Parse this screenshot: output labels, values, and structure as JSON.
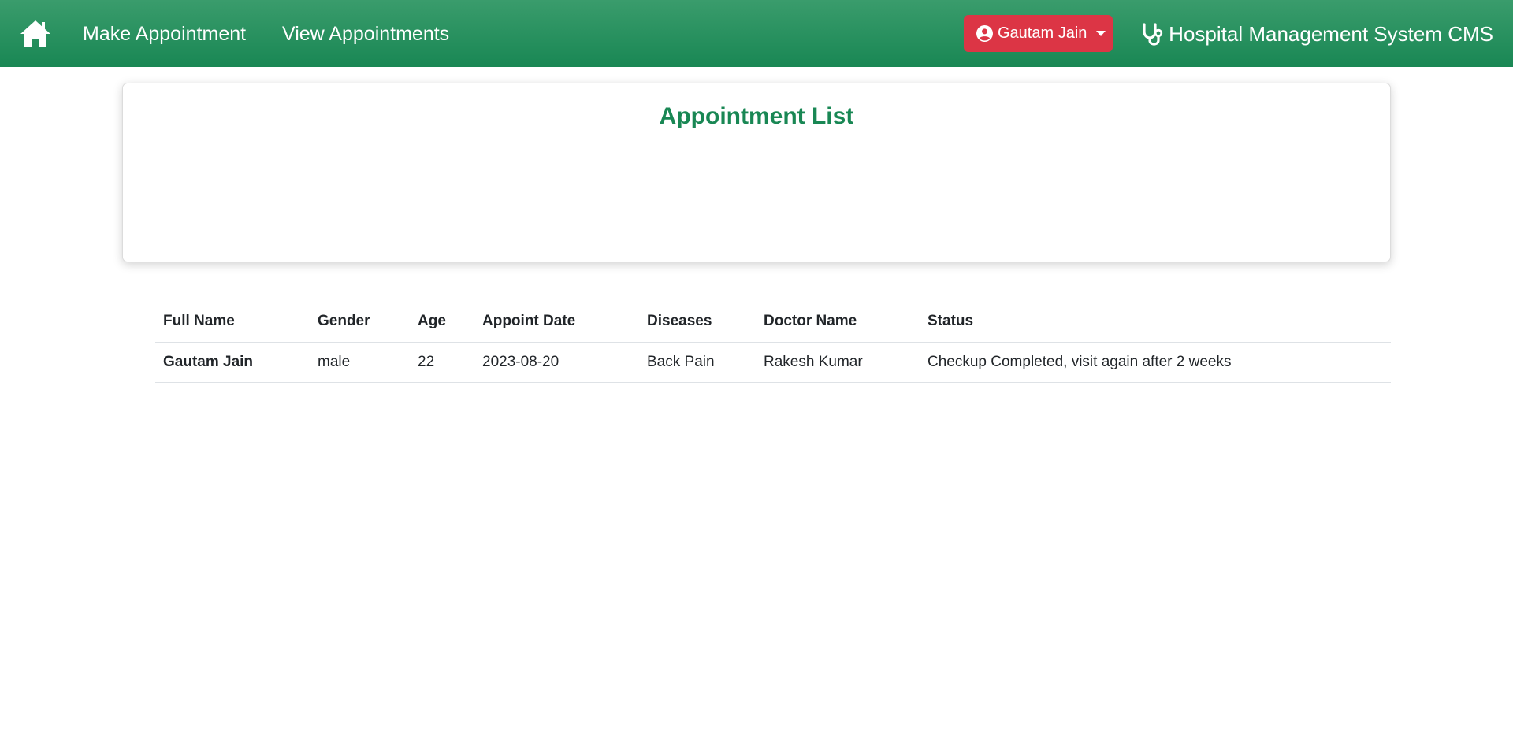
{
  "navbar": {
    "home_icon": "home-icon",
    "links": [
      "Make Appointment",
      "View Appointments"
    ],
    "user_menu": {
      "label": "Gautam Jain",
      "icon": "user-circle-icon"
    },
    "brand": {
      "label": "Hospital Management System CMS",
      "icon": "stethoscope-icon"
    },
    "colors": {
      "navbar": "#198754",
      "user_button": "#dc3545"
    }
  },
  "card": {
    "title": "Appointment List",
    "title_color": "#198754",
    "table": {
      "headers": [
        "Full Name",
        "Gender",
        "Age",
        "Appoint Date",
        "Diseases",
        "Doctor Name",
        "Status"
      ],
      "rows": [
        [
          "Gautam Jain",
          "male",
          "22",
          "2023-08-20",
          "Back Pain",
          "Rakesh Kumar",
          "Checkup Completed, visit again after 2 weeks"
        ]
      ]
    }
  }
}
